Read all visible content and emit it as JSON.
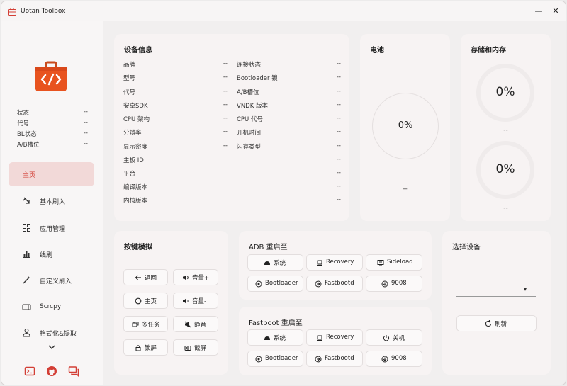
{
  "window": {
    "title": "Uotan Toolbox",
    "accent": "#d33e35"
  },
  "titlebar": {
    "minimize_glyph": "—",
    "close_glyph": "✕"
  },
  "sidebar": {
    "status": [
      {
        "label": "状态",
        "value": "--"
      },
      {
        "label": "代号",
        "value": "--"
      },
      {
        "label": "BL状态",
        "value": "--"
      },
      {
        "label": "A/B槽位",
        "value": "--"
      }
    ],
    "nav": [
      {
        "label": "主页",
        "icon": "home",
        "active": true
      },
      {
        "label": "基本刷入",
        "icon": "flash-icon"
      },
      {
        "label": "应用管理",
        "icon": "apps-icon"
      },
      {
        "label": "线刷",
        "icon": "chart-icon"
      },
      {
        "label": "自定义刷入",
        "icon": "wand-icon"
      },
      {
        "label": "Scrcpy",
        "icon": "screen-icon"
      },
      {
        "label": "格式化&提取",
        "icon": "user-icon"
      }
    ],
    "bottom_icons": [
      "terminal-icon",
      "github-icon",
      "chat-icon"
    ]
  },
  "device_info": {
    "title": "设备信息",
    "left": [
      {
        "label": "品牌",
        "value": "--"
      },
      {
        "label": "型号",
        "value": "--"
      },
      {
        "label": "代号",
        "value": "--"
      },
      {
        "label": "安卓SDK",
        "value": "--"
      },
      {
        "label": "CPU 架构",
        "value": "--"
      },
      {
        "label": "分辨率",
        "value": "--"
      },
      {
        "label": "显示密度",
        "value": "--"
      }
    ],
    "right": [
      {
        "label": "连接状态",
        "value": "--"
      },
      {
        "label": "Bootloader 锁",
        "value": "--"
      },
      {
        "label": "A/B槽位",
        "value": "--"
      },
      {
        "label": "VNDK 版本",
        "value": "--"
      },
      {
        "label": "CPU 代号",
        "value": "--"
      },
      {
        "label": "开机时间",
        "value": "--"
      },
      {
        "label": "闪存类型",
        "value": "--"
      }
    ],
    "full": [
      {
        "label": "主板 ID",
        "value": "--"
      },
      {
        "label": "平台",
        "value": "--"
      },
      {
        "label": "编译版本",
        "value": "--"
      },
      {
        "label": "内核版本",
        "value": "--"
      }
    ]
  },
  "battery": {
    "title": "电池",
    "percent": "0%",
    "status": "--"
  },
  "storage": {
    "title": "存储和内存",
    "storage_percent": "0%",
    "storage_status": "--",
    "memory_percent": "0%",
    "memory_status": "--"
  },
  "keys": {
    "title": "按键模拟",
    "buttons": [
      {
        "label": "返回",
        "icon": "back-icon"
      },
      {
        "label": "音量+",
        "icon": "volume-up-icon"
      },
      {
        "label": "主页",
        "icon": "home-circle-icon"
      },
      {
        "label": "音量-",
        "icon": "volume-down-icon"
      },
      {
        "label": "多任务",
        "icon": "multitask-icon"
      },
      {
        "label": "静音",
        "icon": "mute-icon"
      },
      {
        "label": "锁屏",
        "icon": "lock-icon"
      },
      {
        "label": "截屏",
        "icon": "camera-icon"
      }
    ]
  },
  "adb": {
    "title": "ADB 重启至",
    "buttons": [
      {
        "label": "系统",
        "icon": "android-icon"
      },
      {
        "label": "Recovery",
        "icon": "laptop-icon"
      },
      {
        "label": "Sideload",
        "icon": "sideload-icon"
      },
      {
        "label": "Bootloader",
        "icon": "bootloader-icon"
      },
      {
        "label": "Fastbootd",
        "icon": "fastbootd-icon"
      },
      {
        "label": "9008",
        "icon": "download-circle-icon"
      }
    ]
  },
  "fastboot": {
    "title": "Fastboot 重启至",
    "buttons": [
      {
        "label": "系统",
        "icon": "android-icon"
      },
      {
        "label": "Recovery",
        "icon": "laptop-icon"
      },
      {
        "label": "关机",
        "icon": "power-icon"
      },
      {
        "label": "Bootloader",
        "icon": "bootloader-icon"
      },
      {
        "label": "Fastbootd",
        "icon": "fastbootd-icon"
      },
      {
        "label": "9008",
        "icon": "download-circle-icon"
      }
    ]
  },
  "select_device": {
    "title": "选择设备",
    "value": "",
    "refresh_label": "刷新"
  }
}
